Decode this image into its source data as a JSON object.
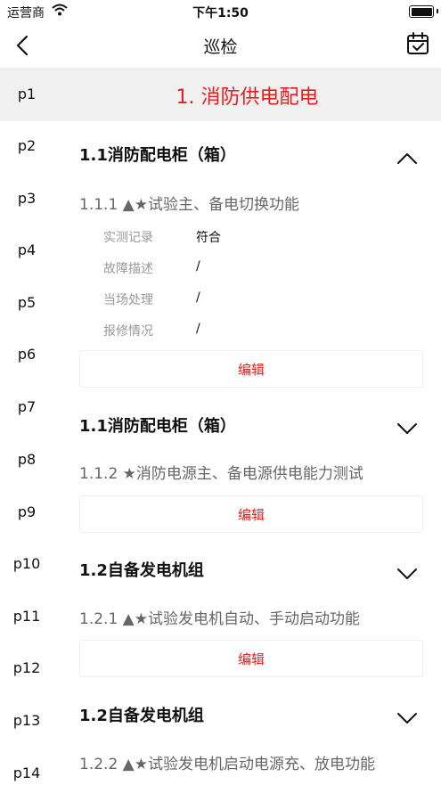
{
  "status_bar": {
    "carrier": "运营商",
    "time": "下午1:50"
  },
  "nav": {
    "title": "巡检",
    "back_icon": "chevron-left-icon",
    "calendar_icon": "calendar-check-icon"
  },
  "sidebar": {
    "items": [
      "p1",
      "p2",
      "p3",
      "p4",
      "p5",
      "p6",
      "p7",
      "p8",
      "p9",
      "p10",
      "p11",
      "p12",
      "p13",
      "p14"
    ],
    "active_index": 0
  },
  "section": {
    "title": "1. 消防供电配电"
  },
  "groups": [
    {
      "title": "1.1消防配电柜（箱）",
      "expanded": true,
      "item": "1.1.1 ▲★试验主、备电切换功能",
      "details": [
        {
          "label": "实测记录",
          "value": "符合"
        },
        {
          "label": "故障描述",
          "value": "/"
        },
        {
          "label": "当场处理",
          "value": "/"
        },
        {
          "label": "报修情况",
          "value": "/"
        }
      ],
      "edit_label": "编辑"
    },
    {
      "title": "1.1消防配电柜（箱）",
      "expanded": false,
      "item": "1.1.2 ★消防电源主、备电源供电能力测试",
      "edit_label": "编辑"
    },
    {
      "title": "1.2自备发电机组",
      "expanded": false,
      "item": "1.2.1 ▲★试验发电机自动、手动启动功能",
      "edit_label": "编辑"
    },
    {
      "title": "1.2自备发电机组",
      "expanded": false,
      "item": "1.2.2 ▲★试验发电机启动电源充、放电功能"
    }
  ],
  "colors": {
    "accent": "#e41e1e",
    "section_bg": "#f0f0f0",
    "muted_text": "#999999"
  }
}
